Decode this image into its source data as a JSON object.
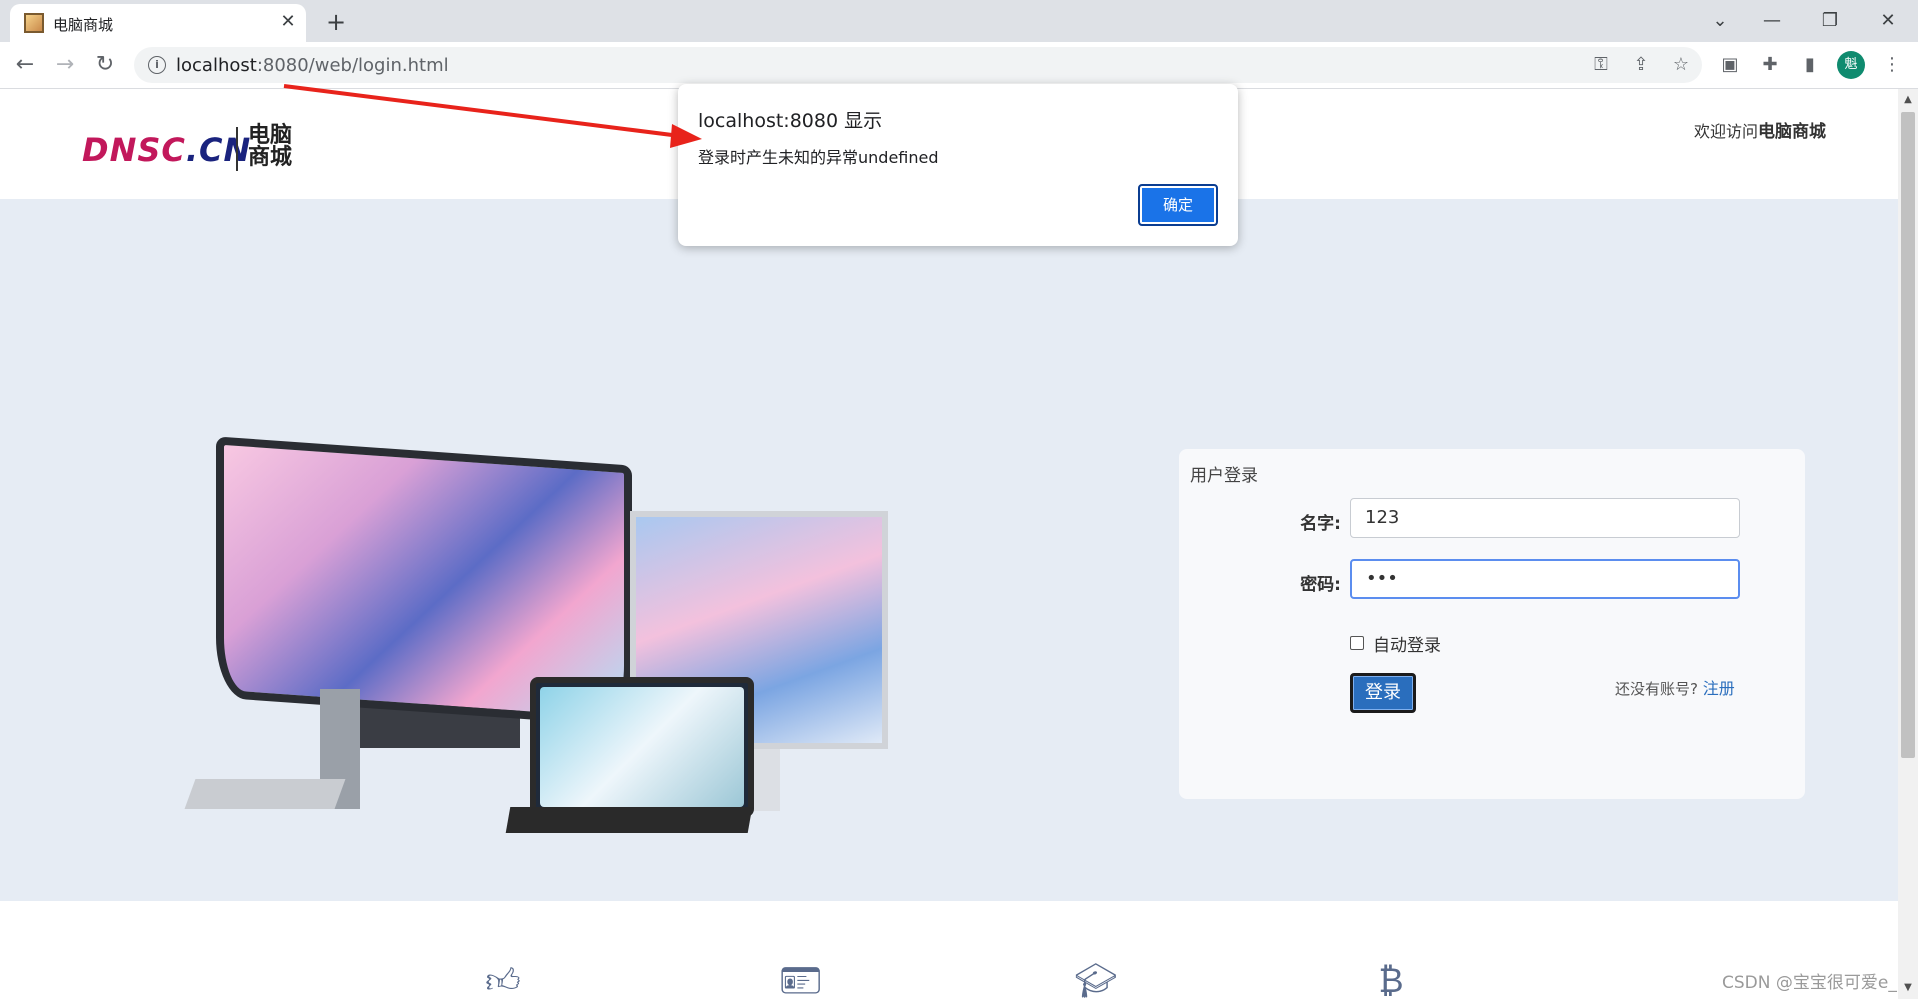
{
  "browser": {
    "tab_title": "电脑商城",
    "tab_close": "✕",
    "new_tab": "+",
    "url_host": "localhost",
    "url_rest": ":8080/web/login.html",
    "win_chevron": "⌄",
    "win_minimize": "—",
    "win_restore": "❐",
    "win_close": "✕",
    "avatar_letter": "魁"
  },
  "header": {
    "logo_text_a": "DNSC",
    "logo_text_b": ".CN",
    "logo_cn": "电脑商城",
    "welcome_prefix": "欢迎访问",
    "welcome_brand": "电脑商城"
  },
  "login": {
    "title": "用户登录",
    "name_label": "名字:",
    "name_value": "123",
    "password_label": "密码:",
    "password_value": "•••",
    "auto_login_label": "自动登录",
    "submit_label": "登录",
    "no_account_text": "还没有账号?",
    "register_link": "注册"
  },
  "dialog": {
    "title": "localhost:8080 显示",
    "message": "登录时产生未知的异常undefined",
    "ok_label": "确定"
  },
  "features": {
    "icons": [
      "thumbs-up-icon",
      "id-card-icon",
      "graduation-cap-icon",
      "bitcoin-icon"
    ]
  },
  "watermark": "CSDN @宝宝很可爱e_",
  "colors": {
    "accent_blue": "#1a73e8",
    "hero_bg": "#e6ecf4",
    "logo_pink": "#c2185b",
    "arrow_red": "#e8231b",
    "link_blue": "#2a6ebd"
  }
}
